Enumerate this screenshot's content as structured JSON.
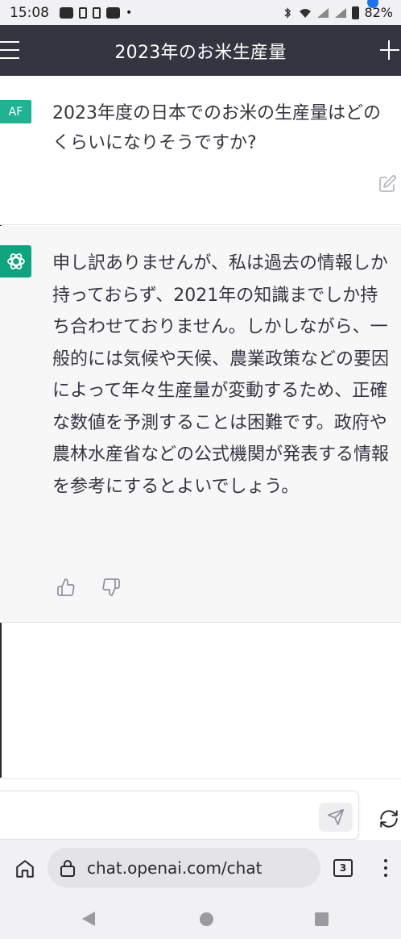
{
  "status_bar": {
    "time": "15:08",
    "battery": "82%"
  },
  "header": {
    "title": "2023年のお米生産量"
  },
  "conversation": {
    "user": {
      "avatar": "AF",
      "message": "2023年度の日本でのお米の生産量はどのくらいになりそうですか?"
    },
    "assistant": {
      "message": "申し訳ありませんが、私は過去の情報しか持っておらず、2021年の知識までしか持ち合わせておりません。しかしながら、一般的には気候や天候、農業政策などの要因によって年々生産量が変動するため、正確な数値を予測することは困難です。政府や農林水産省などの公式機関が発表する情報を参考にするとよいでしょう。"
    }
  },
  "input": {
    "placeholder": ""
  },
  "browser": {
    "url": "chat.openai.com/chat",
    "tab_count": "3"
  },
  "colors": {
    "header_bg": "#343541",
    "user_avatar": "#1fb391",
    "assistant_avatar": "#10a37f",
    "assistant_bg": "#f7f7f8"
  },
  "icons": [
    "menu-icon",
    "plus-icon",
    "edit-icon",
    "openai-logo-icon",
    "thumbs-up-icon",
    "thumbs-down-icon",
    "send-icon",
    "regenerate-icon",
    "home-icon",
    "lock-icon",
    "tabs-icon",
    "more-icon"
  ]
}
